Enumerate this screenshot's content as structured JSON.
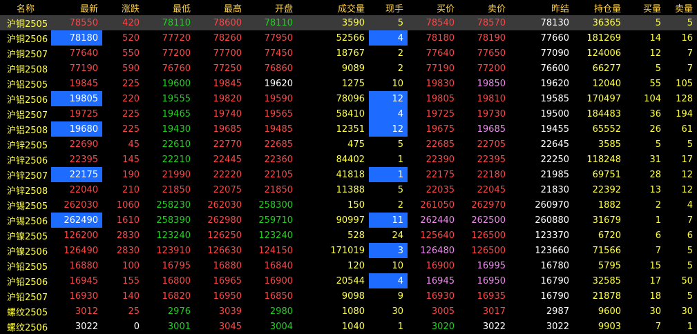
{
  "columns": [
    "名称",
    "最新",
    "涨跌",
    "最低",
    "最高",
    "开盘",
    "成交量",
    "现手",
    "买价",
    "卖价",
    "昨结",
    "持仓量",
    "买量",
    "卖量"
  ],
  "colors": {
    "up": "#ff4545",
    "down": "#1fd21f",
    "flat": "#ffffff",
    "volume": "#ffff44",
    "purple": "#ee88ee",
    "header": "#ffd24a",
    "highlight_bg": "#1e6bff",
    "selected_row_bg": "#3a3a3a"
  },
  "rows": [
    {
      "name": "沪铜2505",
      "latest": "78550",
      "change": "420",
      "low": "78110",
      "high": "78600",
      "open": "78110",
      "volume": "3590",
      "lot": "5",
      "bid": "78540",
      "ask": "78570",
      "prev_settle": "78130",
      "oi": "36365",
      "bid_qty": "5",
      "ask_qty": "5",
      "selected": true,
      "cls": {
        "latest": "up",
        "change": "up",
        "low": "down",
        "high": "up",
        "open": "down",
        "bid": "up",
        "ask": "up"
      }
    },
    {
      "name": "沪铜2506",
      "latest": "78180",
      "change": "520",
      "low": "77720",
      "high": "78260",
      "open": "77950",
      "volume": "52566",
      "lot": "4",
      "bid": "78180",
      "ask": "78190",
      "prev_settle": "77660",
      "oi": "181269",
      "bid_qty": "14",
      "ask_qty": "16",
      "hl": [
        "latest",
        "lot"
      ],
      "cls": {
        "latest": "up",
        "change": "up",
        "low": "up",
        "high": "up",
        "open": "up",
        "bid": "up",
        "ask": "up"
      }
    },
    {
      "name": "沪铜2507",
      "latest": "77640",
      "change": "550",
      "low": "77200",
      "high": "77700",
      "open": "77450",
      "volume": "18767",
      "lot": "2",
      "bid": "77640",
      "ask": "77650",
      "prev_settle": "77090",
      "oi": "124006",
      "bid_qty": "12",
      "ask_qty": "7",
      "cls": {
        "latest": "up",
        "change": "up",
        "low": "up",
        "high": "up",
        "open": "up",
        "bid": "up",
        "ask": "up"
      }
    },
    {
      "name": "沪铜2508",
      "latest": "77190",
      "change": "590",
      "low": "76760",
      "high": "77250",
      "open": "76860",
      "volume": "9089",
      "lot": "2",
      "bid": "77190",
      "ask": "77200",
      "prev_settle": "76600",
      "oi": "66277",
      "bid_qty": "5",
      "ask_qty": "7",
      "cls": {
        "latest": "up",
        "change": "up",
        "low": "up",
        "high": "up",
        "open": "up",
        "bid": "up",
        "ask": "up"
      }
    },
    {
      "name": "沪铝2505",
      "latest": "19845",
      "change": "225",
      "low": "19600",
      "high": "19845",
      "open": "19620",
      "volume": "1275",
      "lot": "10",
      "bid": "19830",
      "ask": "19850",
      "prev_settle": "19620",
      "oi": "12040",
      "bid_qty": "55",
      "ask_qty": "105",
      "cls": {
        "latest": "up",
        "change": "up",
        "low": "down",
        "high": "up",
        "open": "flat",
        "bid": "up",
        "ask": "purple"
      }
    },
    {
      "name": "沪铝2506",
      "latest": "19805",
      "change": "220",
      "low": "19555",
      "high": "19820",
      "open": "19590",
      "volume": "78096",
      "lot": "12",
      "bid": "19805",
      "ask": "19810",
      "prev_settle": "19585",
      "oi": "170497",
      "bid_qty": "104",
      "ask_qty": "128",
      "hl": [
        "latest",
        "lot"
      ],
      "cls": {
        "latest": "up",
        "change": "up",
        "low": "down",
        "high": "up",
        "open": "up",
        "bid": "up",
        "ask": "up"
      }
    },
    {
      "name": "沪铝2507",
      "latest": "19725",
      "change": "225",
      "low": "19465",
      "high": "19740",
      "open": "19565",
      "volume": "58410",
      "lot": "4",
      "bid": "19725",
      "ask": "19730",
      "prev_settle": "19500",
      "oi": "184483",
      "bid_qty": "36",
      "ask_qty": "194",
      "hl": [
        "lot"
      ],
      "cls": {
        "latest": "up",
        "change": "up",
        "low": "down",
        "high": "up",
        "open": "up",
        "bid": "up",
        "ask": "up"
      }
    },
    {
      "name": "沪铝2508",
      "latest": "19680",
      "change": "225",
      "low": "19430",
      "high": "19685",
      "open": "19485",
      "volume": "12351",
      "lot": "12",
      "bid": "19675",
      "ask": "19685",
      "prev_settle": "19455",
      "oi": "65552",
      "bid_qty": "26",
      "ask_qty": "61",
      "hl": [
        "latest",
        "lot"
      ],
      "cls": {
        "latest": "up",
        "change": "up",
        "low": "down",
        "high": "up",
        "open": "up",
        "bid": "up",
        "ask": "purple"
      }
    },
    {
      "name": "沪锌2505",
      "latest": "22690",
      "change": "45",
      "low": "22610",
      "high": "22770",
      "open": "22685",
      "volume": "475",
      "lot": "5",
      "bid": "22685",
      "ask": "22705",
      "prev_settle": "22645",
      "oi": "3585",
      "bid_qty": "5",
      "ask_qty": "5",
      "cls": {
        "latest": "up",
        "change": "up",
        "low": "down",
        "high": "up",
        "open": "up",
        "bid": "up",
        "ask": "up"
      }
    },
    {
      "name": "沪锌2506",
      "latest": "22395",
      "change": "145",
      "low": "22210",
      "high": "22445",
      "open": "22360",
      "volume": "84402",
      "lot": "1",
      "bid": "22390",
      "ask": "22395",
      "prev_settle": "22250",
      "oi": "118248",
      "bid_qty": "31",
      "ask_qty": "17",
      "cls": {
        "latest": "up",
        "change": "up",
        "low": "down",
        "high": "up",
        "open": "up",
        "bid": "up",
        "ask": "up"
      }
    },
    {
      "name": "沪锌2507",
      "latest": "22175",
      "change": "190",
      "low": "21990",
      "high": "22220",
      "open": "22105",
      "volume": "41818",
      "lot": "1",
      "bid": "22175",
      "ask": "22180",
      "prev_settle": "21985",
      "oi": "69751",
      "bid_qty": "28",
      "ask_qty": "12",
      "hl": [
        "latest",
        "lot"
      ],
      "cls": {
        "latest": "up",
        "change": "up",
        "low": "up",
        "high": "up",
        "open": "up",
        "bid": "up",
        "ask": "up"
      }
    },
    {
      "name": "沪锌2508",
      "latest": "22040",
      "change": "210",
      "low": "21850",
      "high": "22075",
      "open": "21850",
      "volume": "11388",
      "lot": "5",
      "bid": "22035",
      "ask": "22045",
      "prev_settle": "21830",
      "oi": "22392",
      "bid_qty": "13",
      "ask_qty": "12",
      "cls": {
        "latest": "up",
        "change": "up",
        "low": "up",
        "high": "up",
        "open": "up",
        "bid": "up",
        "ask": "up"
      }
    },
    {
      "name": "沪锡2505",
      "latest": "262030",
      "change": "1060",
      "low": "258230",
      "high": "262030",
      "open": "258300",
      "volume": "150",
      "lot": "2",
      "bid": "261050",
      "ask": "262970",
      "prev_settle": "260970",
      "oi": "1882",
      "bid_qty": "2",
      "ask_qty": "4",
      "cls": {
        "latest": "up",
        "change": "up",
        "low": "down",
        "high": "up",
        "open": "down",
        "bid": "up",
        "ask": "up"
      }
    },
    {
      "name": "沪锡2506",
      "latest": "262490",
      "change": "1610",
      "low": "258390",
      "high": "262980",
      "open": "259710",
      "volume": "90997",
      "lot": "11",
      "bid": "262440",
      "ask": "262500",
      "prev_settle": "260880",
      "oi": "31679",
      "bid_qty": "1",
      "ask_qty": "7",
      "hl": [
        "latest",
        "lot"
      ],
      "cls": {
        "latest": "up",
        "change": "up",
        "low": "down",
        "high": "up",
        "open": "down",
        "bid": "purple",
        "ask": "purple"
      }
    },
    {
      "name": "沪镍2505",
      "latest": "126200",
      "change": "2830",
      "low": "123240",
      "high": "126250",
      "open": "123240",
      "volume": "528",
      "lot": "24",
      "bid": "125640",
      "ask": "126500",
      "prev_settle": "123370",
      "oi": "6720",
      "bid_qty": "6",
      "ask_qty": "6",
      "cls": {
        "latest": "up",
        "change": "up",
        "low": "down",
        "high": "up",
        "open": "down",
        "bid": "up",
        "ask": "up"
      }
    },
    {
      "name": "沪镍2506",
      "latest": "126490",
      "change": "2830",
      "low": "123910",
      "high": "126630",
      "open": "124150",
      "volume": "171019",
      "lot": "3",
      "bid": "126480",
      "ask": "126500",
      "prev_settle": "123660",
      "oi": "71566",
      "bid_qty": "7",
      "ask_qty": "5",
      "hl": [
        "lot"
      ],
      "cls": {
        "latest": "up",
        "change": "up",
        "low": "up",
        "high": "up",
        "open": "up",
        "bid": "purple",
        "ask": "up"
      }
    },
    {
      "name": "沪铅2505",
      "latest": "16880",
      "change": "100",
      "low": "16795",
      "high": "16880",
      "open": "16840",
      "volume": "120",
      "lot": "10",
      "bid": "16900",
      "ask": "16995",
      "prev_settle": "16780",
      "oi": "5795",
      "bid_qty": "15",
      "ask_qty": "5",
      "cls": {
        "latest": "up",
        "change": "up",
        "low": "up",
        "high": "up",
        "open": "up",
        "bid": "up",
        "ask": "purple"
      }
    },
    {
      "name": "沪铅2506",
      "latest": "16945",
      "change": "155",
      "low": "16800",
      "high": "16965",
      "open": "16900",
      "volume": "20544",
      "lot": "4",
      "bid": "16945",
      "ask": "16950",
      "prev_settle": "16790",
      "oi": "32585",
      "bid_qty": "17",
      "ask_qty": "50",
      "hl": [
        "lot"
      ],
      "cls": {
        "latest": "up",
        "change": "up",
        "low": "up",
        "high": "up",
        "open": "up",
        "bid": "purple",
        "ask": "purple"
      }
    },
    {
      "name": "沪铅2507",
      "latest": "16930",
      "change": "140",
      "low": "16820",
      "high": "16950",
      "open": "16850",
      "volume": "9098",
      "lot": "9",
      "bid": "16930",
      "ask": "16935",
      "prev_settle": "16790",
      "oi": "21878",
      "bid_qty": "18",
      "ask_qty": "5",
      "cls": {
        "latest": "up",
        "change": "up",
        "low": "up",
        "high": "up",
        "open": "up",
        "bid": "up",
        "ask": "up"
      }
    },
    {
      "name": "螺纹2505",
      "latest": "3012",
      "change": "25",
      "low": "2976",
      "high": "3039",
      "open": "2980",
      "volume": "1080",
      "lot": "30",
      "bid": "3005",
      "ask": "3017",
      "prev_settle": "2987",
      "oi": "9600",
      "bid_qty": "30",
      "ask_qty": "30",
      "cls": {
        "latest": "up",
        "change": "up",
        "low": "down",
        "high": "up",
        "open": "down",
        "bid": "up",
        "ask": "up"
      }
    },
    {
      "name": "螺纹2506",
      "latest": "3022",
      "change": "0",
      "low": "3001",
      "high": "3045",
      "open": "3004",
      "volume": "1040",
      "lot": "1",
      "bid": "3020",
      "ask": "3022",
      "prev_settle": "3022",
      "oi": "9903",
      "bid_qty": "7",
      "ask_qty": "1",
      "cls": {
        "latest": "flat",
        "change": "flat",
        "low": "down",
        "high": "up",
        "open": "down",
        "bid": "down",
        "ask": "flat"
      }
    }
  ]
}
